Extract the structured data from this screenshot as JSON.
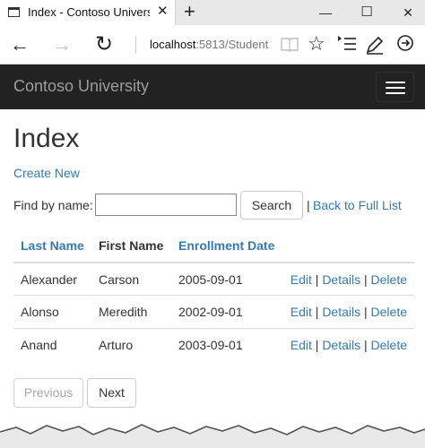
{
  "browser": {
    "tab_title": "Index - Contoso Univers",
    "tab_close": "✕",
    "new_tab": "+",
    "minimize": "—",
    "maximize": "☐",
    "close": "✕",
    "back": "←",
    "forward": "→",
    "refresh": "↻",
    "url_host": "localhost",
    "url_rest": ":5813/Student",
    "favorite": "☆"
  },
  "navbar": {
    "brand": "Contoso University"
  },
  "page": {
    "title": "Index",
    "create_new": "Create New",
    "find_label": "Find by name:",
    "search_value": "",
    "search_button": "Search",
    "separator": "|",
    "back_to_full_list": "Back to Full List"
  },
  "table": {
    "headers": {
      "last_name": "Last Name",
      "first_name": "First Name",
      "enrollment_date": "Enrollment Date"
    },
    "rows": [
      {
        "last": "Alexander",
        "first": "Carson",
        "date": "2005-09-01"
      },
      {
        "last": "Alonso",
        "first": "Meredith",
        "date": "2002-09-01"
      },
      {
        "last": "Anand",
        "first": "Arturo",
        "date": "2003-09-01"
      }
    ],
    "actions": {
      "edit": "Edit",
      "details": "Details",
      "delete": "Delete",
      "sep": "|"
    }
  },
  "pager": {
    "previous": "Previous",
    "next": "Next"
  },
  "colors": {
    "link": "#337ab7",
    "navbar_bg": "#222222",
    "brand_text": "#9d9d9d"
  }
}
